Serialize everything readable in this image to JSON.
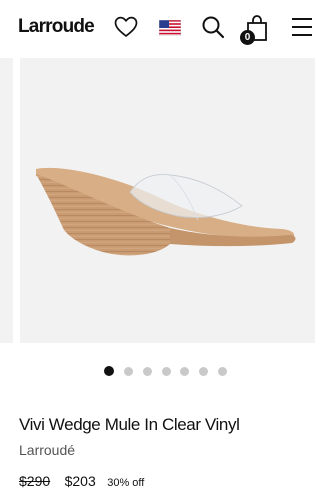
{
  "header": {
    "logo": "Larroude",
    "icons": [
      "heart-icon",
      "us-flag-icon",
      "search-icon",
      "shopping-bag-icon",
      "menu-icon"
    ],
    "cart_count": "0"
  },
  "gallery": {
    "slide_count": 7,
    "active_index": 0,
    "image": "clear vinyl wedge mule, side view"
  },
  "product": {
    "title": "Vivi Wedge Mule In Clear Vinyl",
    "brand": "Larroudé",
    "original_price": "$290",
    "sale_price": "$203",
    "discount": "30% off"
  },
  "colors": {
    "text": "#111111",
    "secondary_text": "#555555",
    "image_bg": "#f2f2f2",
    "dot_inactive": "#c9c9c9",
    "wood": "#c99b72"
  }
}
